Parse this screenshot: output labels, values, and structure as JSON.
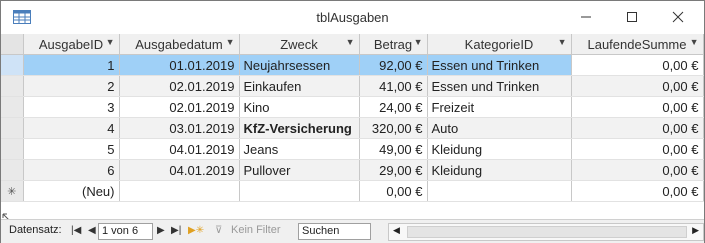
{
  "window": {
    "title": "tblAusgaben"
  },
  "columns": [
    "AusgabeID",
    "Ausgabedatum",
    "Zweck",
    "Betrag",
    "KategorieID",
    "LaufendeSumme"
  ],
  "rows": [
    {
      "id": "1",
      "datum": "01.01.2019",
      "zweck": "Neujahrsessen",
      "betrag": "92,00 €",
      "kategorie": "Essen und Trinken",
      "summe": "0,00 €"
    },
    {
      "id": "2",
      "datum": "02.01.2019",
      "zweck": "Einkaufen",
      "betrag": "41,00 €",
      "kategorie": "Essen und Trinken",
      "summe": "0,00 €"
    },
    {
      "id": "3",
      "datum": "02.01.2019",
      "zweck": "Kino",
      "betrag": "24,00 €",
      "kategorie": "Freizeit",
      "summe": "0,00 €"
    },
    {
      "id": "4",
      "datum": "03.01.2019",
      "zweck": "KfZ-Versicherung",
      "betrag": "320,00 €",
      "kategorie": "Auto",
      "summe": "0,00 €"
    },
    {
      "id": "5",
      "datum": "04.01.2019",
      "zweck": "Jeans",
      "betrag": "49,00 €",
      "kategorie": "Kleidung",
      "summe": "0,00 €"
    },
    {
      "id": "6",
      "datum": "04.01.2019",
      "zweck": "Pullover",
      "betrag": "29,00 €",
      "kategorie": "Kleidung",
      "summe": "0,00 €"
    }
  ],
  "new_row": {
    "marker": "✳",
    "id": "(Neu)",
    "betrag": "0,00 €",
    "summe": "0,00 €"
  },
  "navigation": {
    "label": "Datensatz:",
    "record": "1 von 6",
    "filter": "Kein Filter",
    "search_placeholder": "Suchen"
  }
}
